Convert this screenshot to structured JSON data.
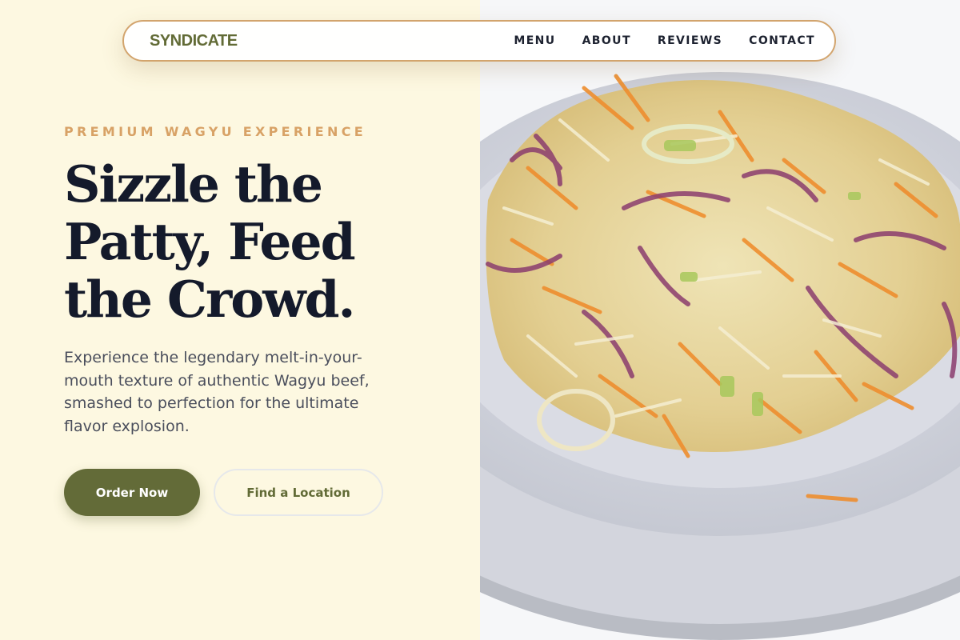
{
  "nav": {
    "brand": "SYNDICATE",
    "links": [
      "MENU",
      "ABOUT",
      "REVIEWS",
      "CONTACT"
    ]
  },
  "hero": {
    "eyebrow": "PREMIUM WAGYU EXPERIENCE",
    "title": "Sizzle the Patty, Feed the Crowd.",
    "description": "Experience the legendary melt-in-your-mouth texture of authentic Wagyu beef, smashed to perfection for the ultimate flavor explosion.",
    "primary_cta": "Order Now",
    "secondary_cta": "Find a Location"
  },
  "image": {
    "subject": "coleslaw-plate-image"
  },
  "colors": {
    "accent": "#636b38",
    "eyebrow": "#d8a266",
    "nav_border": "#d2a46d",
    "background": "#fdf8e1",
    "heading": "#141a2b"
  }
}
